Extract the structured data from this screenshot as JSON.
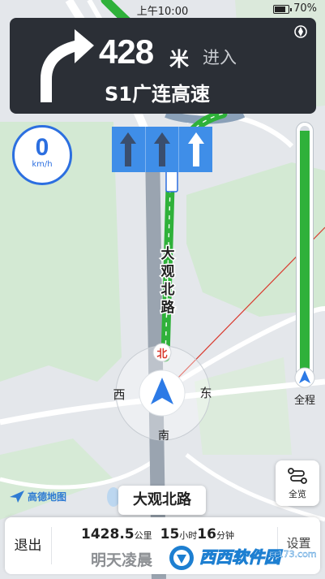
{
  "status_bar": {
    "time": "上午10:00",
    "battery": "70%"
  },
  "nav": {
    "distance": "428",
    "unit": "米",
    "action": "进入",
    "road": "S1广连高速",
    "turn_icon": "turn-right-arrow"
  },
  "lanes": [
    {
      "direction": "straight",
      "recommended": false
    },
    {
      "direction": "straight",
      "recommended": false
    },
    {
      "direction": "straight",
      "recommended": true
    }
  ],
  "speed": {
    "value": "0",
    "unit": "km/h"
  },
  "map": {
    "road_label": "大观北路",
    "north_marker": "北",
    "compass": {
      "west": "西",
      "east": "东",
      "south": "南"
    }
  },
  "progress": {
    "label": "全程",
    "fraction": 0.98,
    "color": "#2fb13a"
  },
  "overview": {
    "label": "全览",
    "icon": "route-icon"
  },
  "brand": {
    "name": "高德地图"
  },
  "current_road": "大观北路",
  "trip": {
    "exit_label": "退出",
    "distance_value": "1428.5",
    "distance_unit": "公里",
    "hours_value": "15",
    "hours_unit": "小时",
    "minutes_value": "16",
    "minutes_unit": "分钟",
    "arrival": "明天凌晨",
    "settings_label": "设置"
  },
  "watermark": {
    "text": "西西软件园",
    "url": "cr173.com"
  },
  "colors": {
    "accent": "#2c6fe0",
    "route": "#2fb13a",
    "card": "#2b2f36",
    "lane": "#3f8ee8"
  }
}
